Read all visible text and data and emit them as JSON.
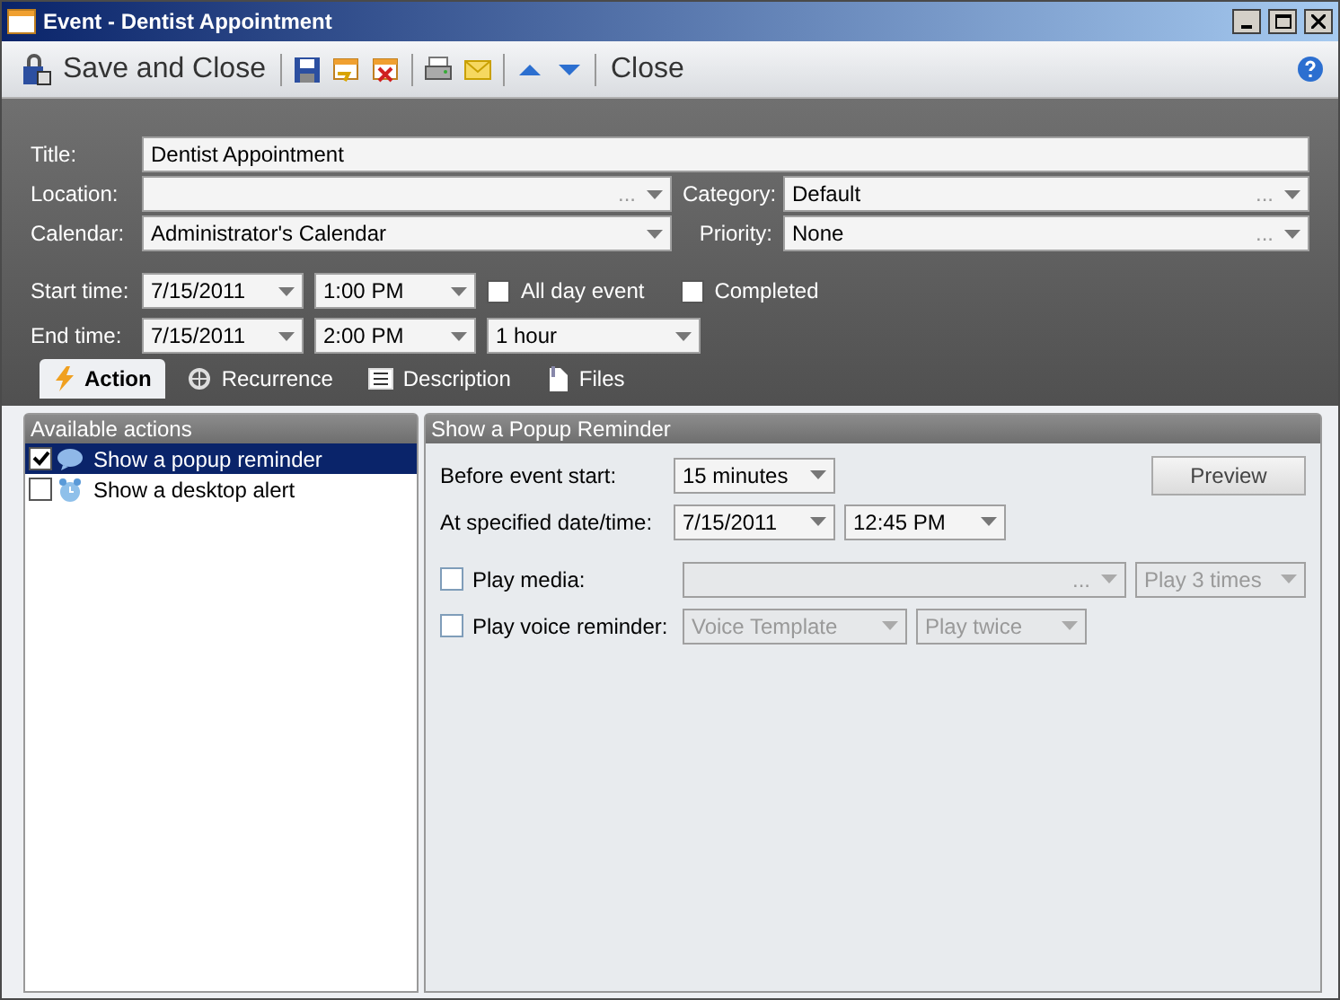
{
  "window": {
    "title": "Event - Dentist Appointment"
  },
  "toolbar": {
    "save_close": "Save and Close",
    "close": "Close"
  },
  "form": {
    "title": {
      "label": "Title:",
      "value": "Dentist Appointment"
    },
    "location": {
      "label": "Location:",
      "browse": "..."
    },
    "category": {
      "label": "Category:",
      "value": "Default",
      "browse": "..."
    },
    "calendar": {
      "label": "Calendar:",
      "value": "Administrator's Calendar"
    },
    "priority": {
      "label": "Priority:",
      "value": "None",
      "browse": "..."
    },
    "start_time": {
      "label": "Start time:",
      "date": "7/15/2011",
      "time": "1:00 PM"
    },
    "all_day": {
      "label": "All day event",
      "checked": false
    },
    "completed": {
      "label": "Completed",
      "checked": false
    },
    "end_time": {
      "label": "End time:",
      "date": "7/15/2011",
      "time": "2:00 PM",
      "duration": "1 hour"
    }
  },
  "tabs": [
    {
      "label": "Action",
      "selected": true
    },
    {
      "label": "Recurrence",
      "selected": false
    },
    {
      "label": "Description",
      "selected": false
    },
    {
      "label": "Files",
      "selected": false
    }
  ],
  "actions": {
    "header": "Available actions",
    "items": [
      {
        "label": "Show a popup reminder",
        "checked": true,
        "selected": true
      },
      {
        "label": "Show a desktop alert",
        "checked": false,
        "selected": false
      }
    ]
  },
  "details": {
    "header": "Show a Popup Reminder",
    "before_start": {
      "label": "Before event start:",
      "value": "15 minutes"
    },
    "at_time": {
      "label": "At specified date/time:",
      "date": "7/15/2011",
      "time": "12:45 PM"
    },
    "preview": "Preview",
    "play_media": {
      "label": "Play media:",
      "checked": false,
      "browse": "...",
      "repeat": "Play 3 times"
    },
    "play_voice": {
      "label": "Play voice reminder:",
      "checked": false,
      "template": "Voice Template",
      "repeat": "Play twice"
    }
  }
}
